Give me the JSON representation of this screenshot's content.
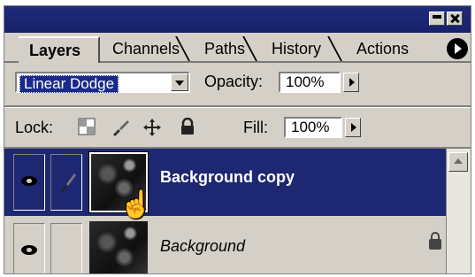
{
  "tabs": [
    {
      "label": "Layers",
      "active": true
    },
    {
      "label": "Channels",
      "active": false
    },
    {
      "label": "Paths",
      "active": false
    },
    {
      "label": "History",
      "active": false
    },
    {
      "label": "Actions",
      "active": false
    }
  ],
  "blend": {
    "mode": "Linear Dodge",
    "opacity_label": "Opacity:",
    "opacity_value": "100%"
  },
  "lock": {
    "label": "Lock:",
    "fill_label": "Fill:",
    "fill_value": "100%"
  },
  "layers": [
    {
      "name": "Background copy",
      "selected": true,
      "locked": false
    },
    {
      "name": "Background",
      "selected": false,
      "locked": true
    }
  ],
  "colors": {
    "titlebar": "#1f2b7a",
    "selection": "#1e2772",
    "panel": "#d4d0c8"
  },
  "icons": {
    "transparency_lock": "checker-icon",
    "paint_lock": "brush-icon",
    "move_lock": "move-icon",
    "all_lock": "padlock-icon"
  }
}
